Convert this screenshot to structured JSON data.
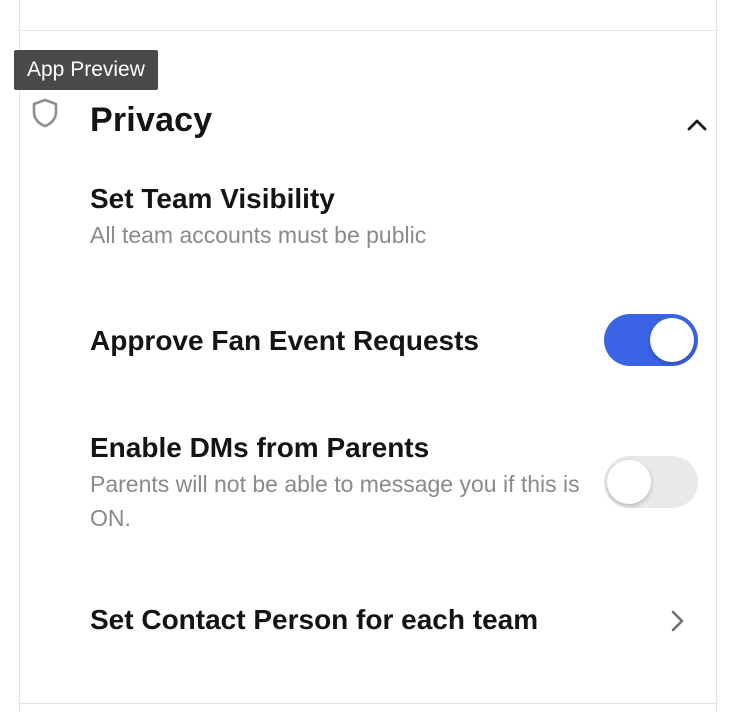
{
  "tooltip": "App Preview",
  "section": {
    "title": "Privacy",
    "icon": "shield-icon",
    "expanded": true
  },
  "settings": [
    {
      "title": "Set Team Visibility",
      "subtitle": "All team accounts must be public"
    },
    {
      "title": "Approve Fan Event Requests",
      "toggle": true
    },
    {
      "title": "Enable DMs from Parents",
      "subtitle": "Parents will not be able to message you if this is ON.",
      "toggle": false
    },
    {
      "title": "Set Contact Person for each team",
      "icon": "chevron-right-icon"
    }
  ],
  "colors": {
    "toggle_on": "#3a63e6",
    "toggle_off": "#e9e9eb",
    "subtitle": "#8a8a8e"
  }
}
